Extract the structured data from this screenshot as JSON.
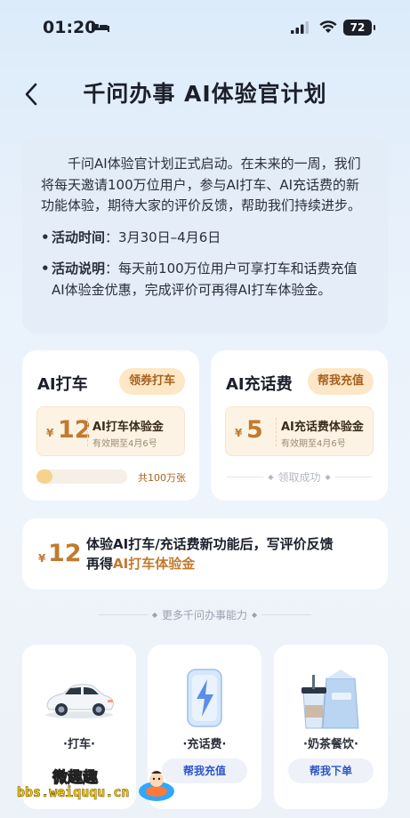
{
  "status_bar": {
    "time": "01:20",
    "battery": "72"
  },
  "header": {
    "title": "千问办事 AI体验官计划"
  },
  "intro": {
    "paragraph": "千问AI体验官计划正式启动。在未来的一周，我们将每天邀请100万位用户，参与AI打车、AI充话费的新功能体验，期待大家的评价反馈，帮助我们持续进步。",
    "bullets": [
      {
        "key": "活动时间",
        "sep": "：",
        "value": "3月30日–4月6日"
      },
      {
        "key": "活动说明",
        "sep": "：",
        "value": "每天前100万位用户可享打车和话费充值AI体验金优惠，完成评价可再得AI打车体验金。"
      }
    ]
  },
  "taxi_card": {
    "title": "AI打车",
    "button": "领券打车",
    "coupon": {
      "yen": "¥",
      "value": "12",
      "name": "AI打车体验金",
      "expiry": "有效期至4月6号"
    },
    "progress": {
      "fraction": 0.18,
      "label": "共100万张"
    }
  },
  "charge_card": {
    "title": "AI充话费",
    "button": "帮我充值",
    "coupon": {
      "yen": "¥",
      "value": "5",
      "name": "AI充话费体验金",
      "expiry": "有效期至4月6号"
    },
    "status": "领取成功"
  },
  "review_card": {
    "yen": "¥",
    "value": "12",
    "line1": "体验AI打车/充话费新功能后，写评价反馈",
    "line2_prefix": "再得",
    "line2_highlight": "AI打车体验金"
  },
  "more_section": {
    "label": "更多千问办事能力"
  },
  "services": [
    {
      "name": "·打车·",
      "button": ""
    },
    {
      "name": "·充话费·",
      "button": "帮我充值"
    },
    {
      "name": "·奶茶餐饮·",
      "button": "帮我下单"
    }
  ],
  "watermark": {
    "title": "微趣趣",
    "url": "bbs.weiququ.cn"
  },
  "colors": {
    "accent_gold": "#c27a2e",
    "pill_bg": "#fde7c7",
    "link_blue": "#2f55c8"
  },
  "icons": [
    "bed-icon",
    "signal-icon",
    "wifi-icon",
    "back-arrow-icon",
    "car-illustration",
    "phone-charge-illustration",
    "milk-tea-illustration"
  ]
}
